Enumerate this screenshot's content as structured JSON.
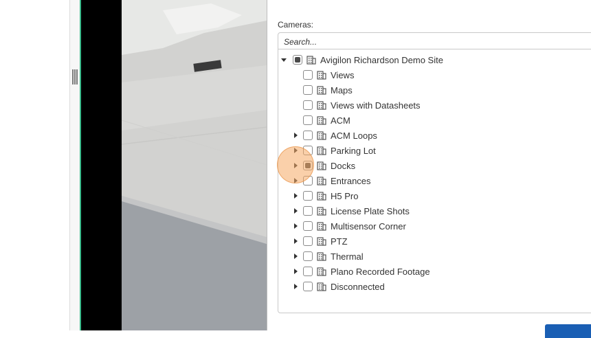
{
  "cameras_label": "Cameras:",
  "search": {
    "placeholder": "Search..."
  },
  "tree": {
    "root": {
      "label": "Avigilon Richardson Demo Site",
      "state": "partial",
      "expanded": true
    },
    "items": [
      {
        "label": "Views",
        "expandable": false,
        "state": "unchecked"
      },
      {
        "label": "Maps",
        "expandable": false,
        "state": "unchecked"
      },
      {
        "label": "Views with Datasheets",
        "expandable": false,
        "state": "unchecked"
      },
      {
        "label": "ACM",
        "expandable": false,
        "state": "unchecked"
      },
      {
        "label": "ACM Loops",
        "expandable": true,
        "state": "unchecked"
      },
      {
        "label": "Parking Lot",
        "expandable": true,
        "state": "unchecked"
      },
      {
        "label": "Docks",
        "expandable": true,
        "state": "partial"
      },
      {
        "label": "Entrances",
        "expandable": true,
        "state": "unchecked"
      },
      {
        "label": "H5 Pro",
        "expandable": true,
        "state": "unchecked"
      },
      {
        "label": "License Plate Shots",
        "expandable": true,
        "state": "unchecked"
      },
      {
        "label": "Multisensor Corner",
        "expandable": true,
        "state": "unchecked"
      },
      {
        "label": "PTZ",
        "expandable": true,
        "state": "unchecked"
      },
      {
        "label": "Thermal",
        "expandable": true,
        "state": "unchecked"
      },
      {
        "label": "Plano Recorded Footage",
        "expandable": true,
        "state": "unchecked"
      },
      {
        "label": "Disconnected",
        "expandable": true,
        "state": "unchecked"
      }
    ]
  },
  "colors": {
    "accent_green": "#3dbb8c",
    "primary_button": "#1a5fb4",
    "highlight": "#f5aa64"
  },
  "icons": {
    "site": "building-icon"
  }
}
